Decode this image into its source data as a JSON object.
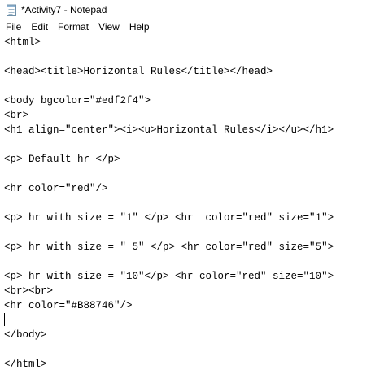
{
  "window": {
    "title": "*Activity7 - Notepad"
  },
  "menubar": {
    "items": [
      "File",
      "Edit",
      "Format",
      "View",
      "Help"
    ]
  },
  "editor": {
    "lines": [
      "<html>",
      "",
      "<head><title>Horizontal Rules</title></head>",
      "",
      "<body bgcolor=\"#edf2f4\">",
      "<br>",
      "<h1 align=\"center\"><i><u>Horizontal Rules</i></u></h1>",
      "",
      "<p> Default hr </p>",
      "",
      "<hr color=\"red\"/>",
      "",
      "<p> hr with size = \"1\" </p> <hr  color=\"red\" size=\"1\">",
      "",
      "<p> hr with size = \" 5\" </p> <hr color=\"red\" size=\"5\">",
      "",
      "<p> hr with size = \"10\"</p> <hr color=\"red\" size=\"10\">",
      "<br><br>",
      "<hr color=\"#B88746\"/>",
      "",
      "</body>",
      "",
      "</html>"
    ]
  },
  "icons": {
    "app": "notepad-icon"
  }
}
